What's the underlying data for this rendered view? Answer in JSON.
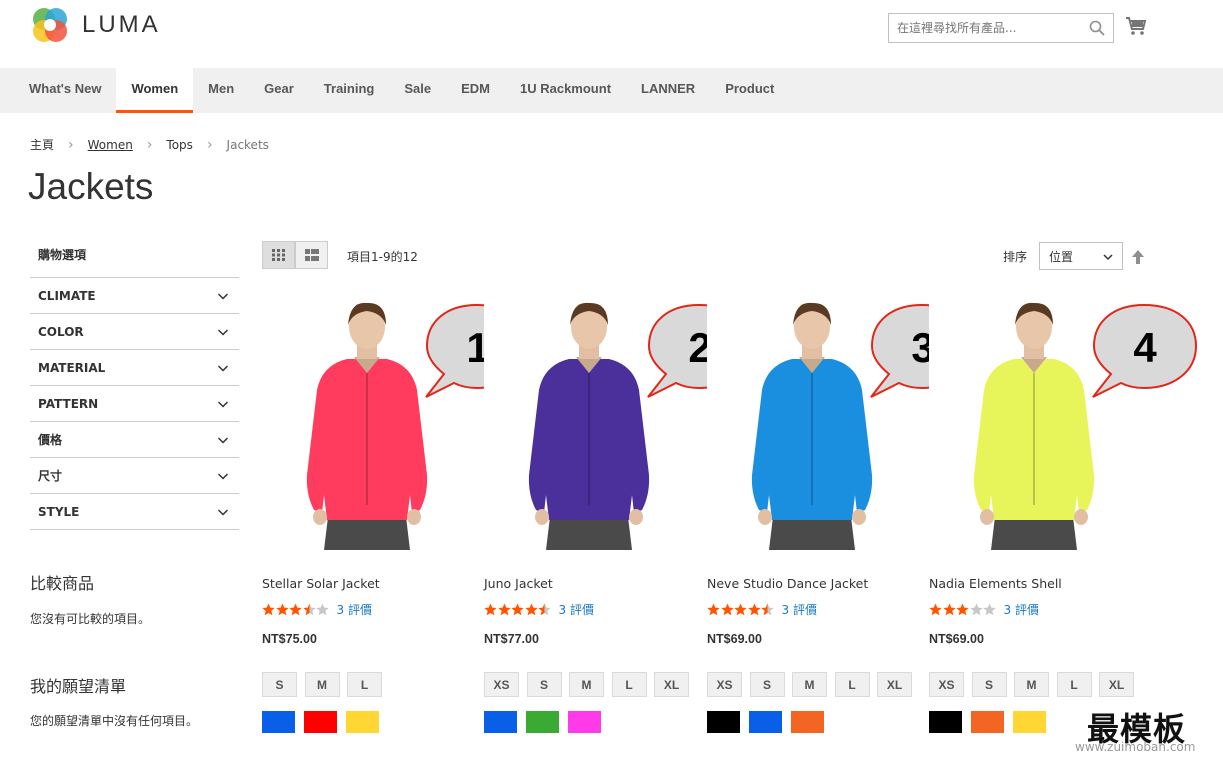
{
  "header": {
    "logo_text": "LUMA",
    "search_placeholder": "在這裡尋找所有產品...",
    "icons": {
      "search": "search-icon",
      "cart": "cart-icon"
    }
  },
  "nav": {
    "items": [
      "What's New",
      "Women",
      "Men",
      "Gear",
      "Training",
      "Sale",
      "EDM",
      "1U Rackmount",
      "LANNER",
      "Product"
    ],
    "active": "Women",
    "accent": "#ff5501"
  },
  "breadcrumb": {
    "home": "主頁",
    "women": "Women",
    "tops": "Tops",
    "current": "Jackets"
  },
  "page_title": "Jackets",
  "sidebar": {
    "shop_by": "購物選項",
    "filters": [
      "CLIMATE",
      "COLOR",
      "MATERIAL",
      "PATTERN",
      "價格",
      "尺寸",
      "STYLE"
    ],
    "compare_title": "比較商品",
    "compare_empty": "您沒有可比較的項目。",
    "wishlist_title": "我的願望清單",
    "wishlist_empty": "您的願望清單中沒有任何項目。"
  },
  "toolbar": {
    "amount": "項目1-9的12",
    "sort_label": "排序",
    "sort_value": "位置",
    "view_modes": [
      "grid-icon",
      "list-icon"
    ]
  },
  "products": [
    {
      "callout": "1",
      "name": "Stellar Solar Jacket",
      "rating": 3.5,
      "reviews": "3 評價",
      "price": "NT$75.00",
      "sizes": [
        "S",
        "M",
        "L"
      ],
      "colors": [
        "#0a5fe8",
        "#ff0000",
        "#ffd633"
      ],
      "garment_color": "#ff3b5e"
    },
    {
      "callout": "2",
      "name": "Juno Jacket",
      "rating": 4.5,
      "reviews": "3 評價",
      "price": "NT$77.00",
      "sizes": [
        "XS",
        "S",
        "M",
        "L",
        "XL"
      ],
      "colors": [
        "#0a5fe8",
        "#3aaa35",
        "#ff3ae8"
      ],
      "garment_color": "#4b2f9a"
    },
    {
      "callout": "3",
      "name": "Neve Studio Dance Jacket",
      "rating": 4.5,
      "reviews": "3 評價",
      "price": "NT$69.00",
      "sizes": [
        "XS",
        "S",
        "M",
        "L",
        "XL"
      ],
      "colors": [
        "#000000",
        "#0a5fe8",
        "#f26522"
      ],
      "garment_color": "#1a8fe0"
    },
    {
      "callout": "4",
      "name": "Nadia Elements Shell",
      "rating": 3,
      "reviews": "3 評價",
      "price": "NT$69.00",
      "sizes": [
        "XS",
        "S",
        "M",
        "L",
        "XL"
      ],
      "colors": [
        "#000000",
        "#f26522",
        "#ffd633"
      ],
      "garment_color": "#e8f55a"
    }
  ],
  "star_color": "#ff5501",
  "watermark": {
    "cn": "最模板",
    "url": "www.zuimoban.com"
  }
}
